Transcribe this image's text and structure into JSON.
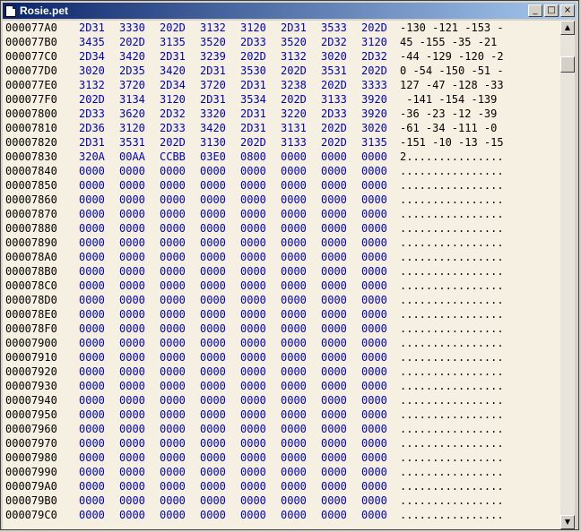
{
  "window": {
    "title": "Rosie.pet",
    "minimize": "_",
    "maximize": "□",
    "close": "×"
  },
  "scrollbar": {
    "up": "▲",
    "down": "▼"
  },
  "rows": [
    {
      "addr": "000077A0",
      "hex": [
        "2D31",
        "3330",
        "202D",
        "3132",
        "3120",
        "2D31",
        "3533",
        "202D"
      ],
      "ascii": "-130 -121 -153 -"
    },
    {
      "addr": "000077B0",
      "hex": [
        "3435",
        "202D",
        "3135",
        "3520",
        "2D33",
        "3520",
        "2D32",
        "3120"
      ],
      "ascii": "45 -155 -35 -21 "
    },
    {
      "addr": "000077C0",
      "hex": [
        "2D34",
        "3420",
        "2D31",
        "3239",
        "202D",
        "3132",
        "3020",
        "2D32"
      ],
      "ascii": "-44 -129 -120 -2"
    },
    {
      "addr": "000077D0",
      "hex": [
        "3020",
        "2D35",
        "3420",
        "2D31",
        "3530",
        "202D",
        "3531",
        "202D"
      ],
      "ascii": "0 -54 -150 -51 -"
    },
    {
      "addr": "000077E0",
      "hex": [
        "3132",
        "3720",
        "2D34",
        "3720",
        "2D31",
        "3238",
        "202D",
        "3333"
      ],
      "ascii": "127 -47 -128 -33"
    },
    {
      "addr": "000077F0",
      "hex": [
        "202D",
        "3134",
        "3120",
        "2D31",
        "3534",
        "202D",
        "3133",
        "3920"
      ],
      "ascii": " -141 -154 -139 "
    },
    {
      "addr": "00007800",
      "hex": [
        "2D33",
        "3620",
        "2D32",
        "3320",
        "2D31",
        "3220",
        "2D33",
        "3920"
      ],
      "ascii": "-36 -23 -12 -39 "
    },
    {
      "addr": "00007810",
      "hex": [
        "2D36",
        "3120",
        "2D33",
        "3420",
        "2D31",
        "3131",
        "202D",
        "3020"
      ],
      "ascii": "-61 -34 -111 -0 "
    },
    {
      "addr": "00007820",
      "hex": [
        "2D31",
        "3531",
        "202D",
        "3130",
        "202D",
        "3133",
        "202D",
        "3135"
      ],
      "ascii": "-151 -10 -13 -15"
    },
    {
      "addr": "00007830",
      "hex": [
        "320A",
        "00AA",
        "CCBB",
        "03E0",
        "0800",
        "0000",
        "0000",
        "0000"
      ],
      "ascii": "2..............."
    },
    {
      "addr": "00007840",
      "hex": [
        "0000",
        "0000",
        "0000",
        "0000",
        "0000",
        "0000",
        "0000",
        "0000"
      ],
      "ascii": "................"
    },
    {
      "addr": "00007850",
      "hex": [
        "0000",
        "0000",
        "0000",
        "0000",
        "0000",
        "0000",
        "0000",
        "0000"
      ],
      "ascii": "................"
    },
    {
      "addr": "00007860",
      "hex": [
        "0000",
        "0000",
        "0000",
        "0000",
        "0000",
        "0000",
        "0000",
        "0000"
      ],
      "ascii": "................"
    },
    {
      "addr": "00007870",
      "hex": [
        "0000",
        "0000",
        "0000",
        "0000",
        "0000",
        "0000",
        "0000",
        "0000"
      ],
      "ascii": "................"
    },
    {
      "addr": "00007880",
      "hex": [
        "0000",
        "0000",
        "0000",
        "0000",
        "0000",
        "0000",
        "0000",
        "0000"
      ],
      "ascii": "................"
    },
    {
      "addr": "00007890",
      "hex": [
        "0000",
        "0000",
        "0000",
        "0000",
        "0000",
        "0000",
        "0000",
        "0000"
      ],
      "ascii": "................"
    },
    {
      "addr": "000078A0",
      "hex": [
        "0000",
        "0000",
        "0000",
        "0000",
        "0000",
        "0000",
        "0000",
        "0000"
      ],
      "ascii": "................"
    },
    {
      "addr": "000078B0",
      "hex": [
        "0000",
        "0000",
        "0000",
        "0000",
        "0000",
        "0000",
        "0000",
        "0000"
      ],
      "ascii": "................"
    },
    {
      "addr": "000078C0",
      "hex": [
        "0000",
        "0000",
        "0000",
        "0000",
        "0000",
        "0000",
        "0000",
        "0000"
      ],
      "ascii": "................"
    },
    {
      "addr": "000078D0",
      "hex": [
        "0000",
        "0000",
        "0000",
        "0000",
        "0000",
        "0000",
        "0000",
        "0000"
      ],
      "ascii": "................"
    },
    {
      "addr": "000078E0",
      "hex": [
        "0000",
        "0000",
        "0000",
        "0000",
        "0000",
        "0000",
        "0000",
        "0000"
      ],
      "ascii": "................"
    },
    {
      "addr": "000078F0",
      "hex": [
        "0000",
        "0000",
        "0000",
        "0000",
        "0000",
        "0000",
        "0000",
        "0000"
      ],
      "ascii": "................"
    },
    {
      "addr": "00007900",
      "hex": [
        "0000",
        "0000",
        "0000",
        "0000",
        "0000",
        "0000",
        "0000",
        "0000"
      ],
      "ascii": "................"
    },
    {
      "addr": "00007910",
      "hex": [
        "0000",
        "0000",
        "0000",
        "0000",
        "0000",
        "0000",
        "0000",
        "0000"
      ],
      "ascii": "................"
    },
    {
      "addr": "00007920",
      "hex": [
        "0000",
        "0000",
        "0000",
        "0000",
        "0000",
        "0000",
        "0000",
        "0000"
      ],
      "ascii": "................"
    },
    {
      "addr": "00007930",
      "hex": [
        "0000",
        "0000",
        "0000",
        "0000",
        "0000",
        "0000",
        "0000",
        "0000"
      ],
      "ascii": "................"
    },
    {
      "addr": "00007940",
      "hex": [
        "0000",
        "0000",
        "0000",
        "0000",
        "0000",
        "0000",
        "0000",
        "0000"
      ],
      "ascii": "................"
    },
    {
      "addr": "00007950",
      "hex": [
        "0000",
        "0000",
        "0000",
        "0000",
        "0000",
        "0000",
        "0000",
        "0000"
      ],
      "ascii": "................"
    },
    {
      "addr": "00007960",
      "hex": [
        "0000",
        "0000",
        "0000",
        "0000",
        "0000",
        "0000",
        "0000",
        "0000"
      ],
      "ascii": "................"
    },
    {
      "addr": "00007970",
      "hex": [
        "0000",
        "0000",
        "0000",
        "0000",
        "0000",
        "0000",
        "0000",
        "0000"
      ],
      "ascii": "................"
    },
    {
      "addr": "00007980",
      "hex": [
        "0000",
        "0000",
        "0000",
        "0000",
        "0000",
        "0000",
        "0000",
        "0000"
      ],
      "ascii": "................"
    },
    {
      "addr": "00007990",
      "hex": [
        "0000",
        "0000",
        "0000",
        "0000",
        "0000",
        "0000",
        "0000",
        "0000"
      ],
      "ascii": "................"
    },
    {
      "addr": "000079A0",
      "hex": [
        "0000",
        "0000",
        "0000",
        "0000",
        "0000",
        "0000",
        "0000",
        "0000"
      ],
      "ascii": "................"
    },
    {
      "addr": "000079B0",
      "hex": [
        "0000",
        "0000",
        "0000",
        "0000",
        "0000",
        "0000",
        "0000",
        "0000"
      ],
      "ascii": "................"
    },
    {
      "addr": "000079C0",
      "hex": [
        "0000",
        "0000",
        "0000",
        "0000",
        "0000",
        "0000",
        "0000",
        "0000"
      ],
      "ascii": "................"
    }
  ]
}
